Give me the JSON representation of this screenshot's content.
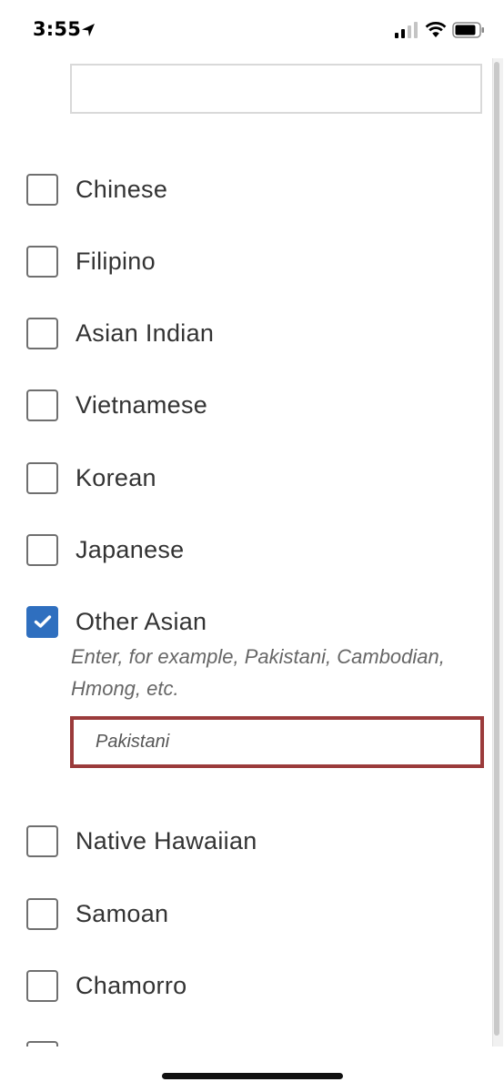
{
  "status_bar": {
    "time": "3:55",
    "icons": [
      "location-arrow-icon",
      "cellular-signal-icon",
      "wifi-icon",
      "battery-icon"
    ]
  },
  "top_input": {
    "value": ""
  },
  "options": [
    {
      "label": "Chinese",
      "checked": false
    },
    {
      "label": "Filipino",
      "checked": false
    },
    {
      "label": "Asian Indian",
      "checked": false
    },
    {
      "label": "Vietnamese",
      "checked": false
    },
    {
      "label": "Korean",
      "checked": false
    },
    {
      "label": "Japanese",
      "checked": false
    },
    {
      "label": "Other Asian",
      "checked": true
    },
    {
      "label": "Native Hawaiian",
      "checked": false
    },
    {
      "label": "Samoan",
      "checked": false
    },
    {
      "label": "Chamorro",
      "checked": false
    }
  ],
  "other_asian": {
    "help_line1": "Enter, for example, Pakistani, Cambodian,",
    "help_line2": "Hmong, etc.",
    "value": "Pakistani"
  },
  "colors": {
    "checked_fill": "#2f6fbf",
    "error_border": "#9b3b3b",
    "checkbox_border": "#6f6f6f"
  }
}
